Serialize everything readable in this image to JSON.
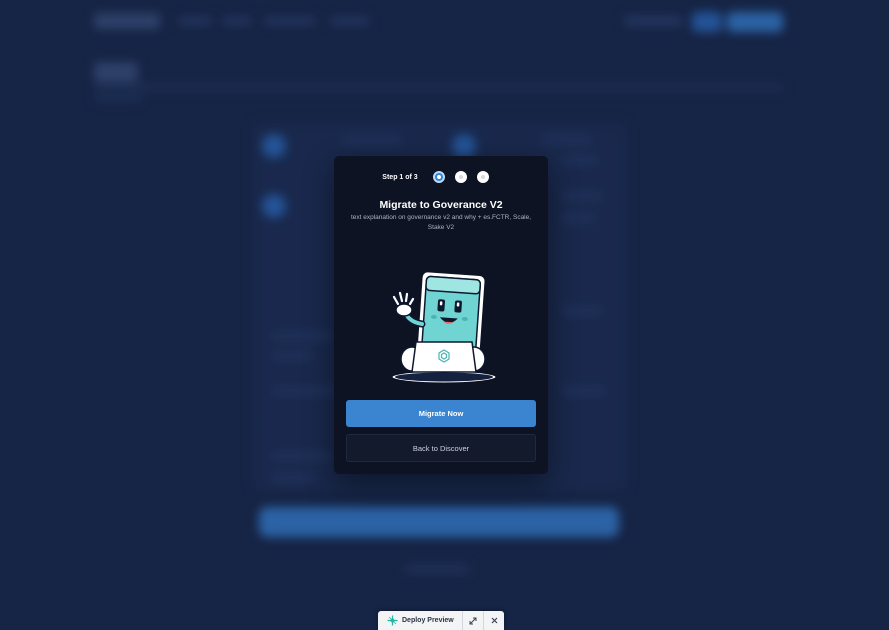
{
  "modal": {
    "step_label": "Step 1 of 3",
    "steps": [
      {
        "state": "active"
      },
      {
        "state": "todo"
      },
      {
        "state": "todo"
      }
    ],
    "title": "Migrate to Goverance V2",
    "description": "text explanation on governance v2 and why + es.FCTR, Scale, Stake V2",
    "primary_button": "Migrate Now",
    "secondary_button": "Back to Discover",
    "illustration": "waving-robot-laptop-mascot"
  },
  "deploy_bar": {
    "label": "Deploy Preview",
    "logo_icon": "netlify-logo-icon",
    "expand_icon": "expand-icon",
    "close_icon": "close-icon"
  },
  "colors": {
    "page_bg": "#1c2d52",
    "modal_bg": "#0d1322",
    "accent": "#3a84d0",
    "mascot_teal": "#6fd4d2"
  }
}
